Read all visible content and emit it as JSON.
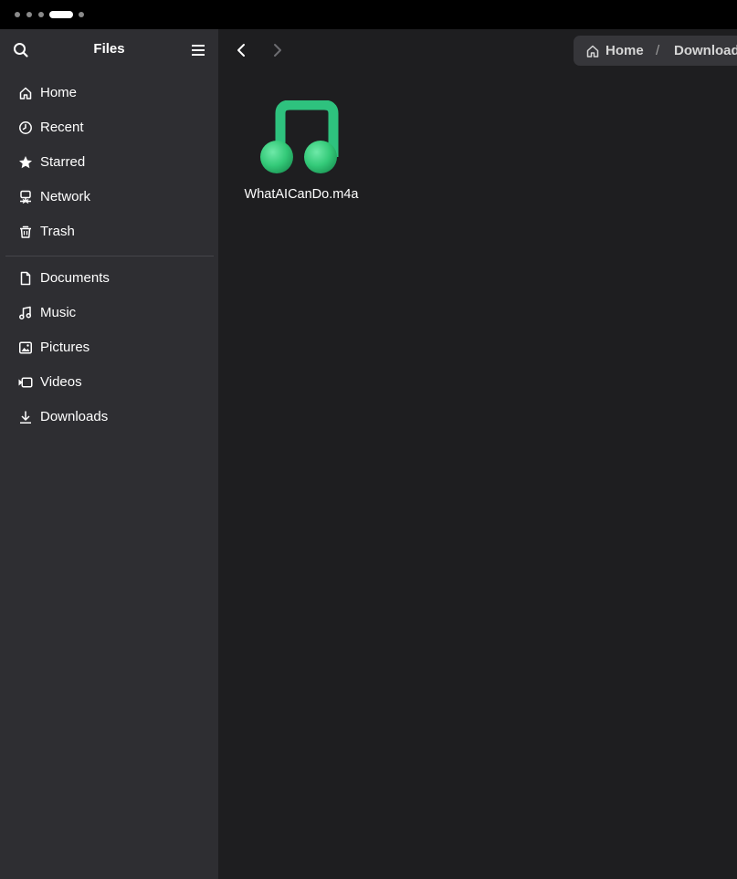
{
  "app": {
    "title": "Files"
  },
  "workspaces": {
    "count": 5,
    "active_index": 3
  },
  "sidebar": {
    "search_icon": "search-icon",
    "menu_icon": "hamburger-menu-icon",
    "places": [
      {
        "label": "Home",
        "icon": "home-icon"
      },
      {
        "label": "Recent",
        "icon": "clock-icon"
      },
      {
        "label": "Starred",
        "icon": "star-icon"
      },
      {
        "label": "Network",
        "icon": "network-icon"
      },
      {
        "label": "Trash",
        "icon": "trash-icon"
      }
    ],
    "bookmarks": [
      {
        "label": "Documents",
        "icon": "document-icon"
      },
      {
        "label": "Music",
        "icon": "music-icon"
      },
      {
        "label": "Pictures",
        "icon": "picture-icon"
      },
      {
        "label": "Videos",
        "icon": "video-icon"
      },
      {
        "label": "Downloads",
        "icon": "download-icon"
      }
    ]
  },
  "toolbar": {
    "back_icon": "chevron-left-icon",
    "forward_icon": "chevron-right-icon"
  },
  "pathbar": {
    "crumbs": [
      "Home",
      "Downloads"
    ],
    "separator": "/"
  },
  "files": [
    {
      "name": "WhatAICanDo.m4a",
      "icon": "music-note-icon",
      "icon_color": "#2ec27e"
    }
  ],
  "colors": {
    "sidebar_bg": "#2e2e32",
    "main_bg": "#1e1e20",
    "accent_green": "#2ec27e"
  }
}
